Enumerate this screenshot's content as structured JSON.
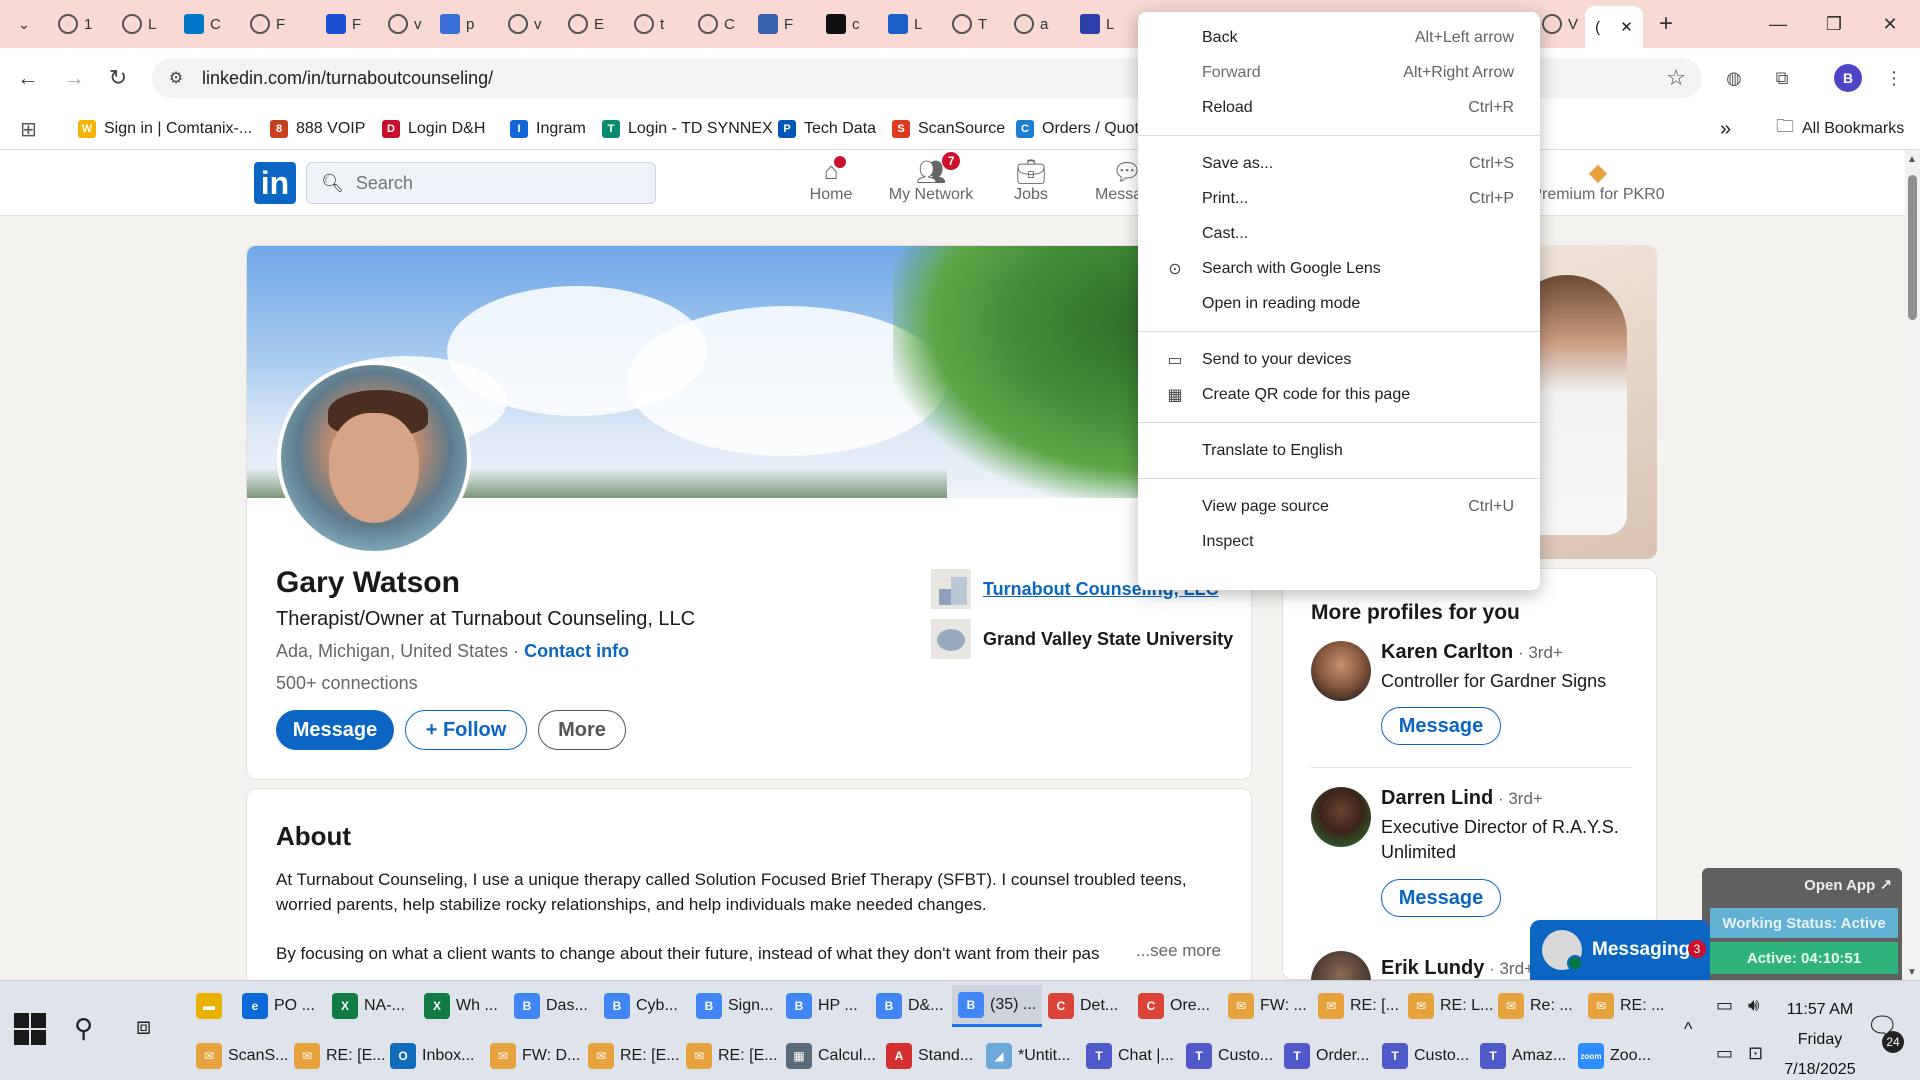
{
  "browser": {
    "tab_letters": [
      "1",
      "L",
      "C",
      "F",
      "F",
      "v",
      "p",
      "v",
      "E",
      "t",
      "C",
      "F",
      "c",
      "L",
      "T",
      "a",
      "L",
      "V"
    ],
    "active_tab_label": "(",
    "url": "linkedin.com/in/turnaboutcounseling/",
    "profile_initial": "B",
    "bookmarks": [
      {
        "label": "Sign in | Comtanix-...",
        "color": "#f2b400",
        "glyph": "W"
      },
      {
        "label": "888 VOIP",
        "color": "#c6411e",
        "glyph": "8"
      },
      {
        "label": "Login D&H",
        "color": "#c8102e",
        "glyph": "D"
      },
      {
        "label": "Ingram",
        "color": "#1366d6",
        "glyph": "I"
      },
      {
        "label": "Login - TD SYNNEX",
        "color": "#0a8a6e",
        "glyph": "T"
      },
      {
        "label": "Tech Data",
        "color": "#0057b8",
        "glyph": "P"
      },
      {
        "label": "ScanSource",
        "color": "#e03a1e",
        "glyph": "S"
      },
      {
        "label": "Orders / Quote",
        "color": "#1b7fd1",
        "glyph": "C"
      }
    ],
    "all_bookmarks_label": "All Bookmarks"
  },
  "linkedin": {
    "search_placeholder": "Search",
    "nav": [
      {
        "label": "Home",
        "badge": ""
      },
      {
        "label": "My Network",
        "badge": "7"
      },
      {
        "label": "Jobs",
        "badge": ""
      },
      {
        "label": "Messa",
        "badge": ""
      }
    ],
    "premium_label": "Premium for PKR0"
  },
  "profile": {
    "name": "Gary Watson",
    "headline": "Therapist/Owner at Turnabout Counseling, LLC",
    "location": "Ada, Michigan, United States",
    "location_sep": " · ",
    "contact_info": "Contact info",
    "connections": "500+ connections",
    "btn_message": "Message",
    "btn_follow": "+ Follow",
    "btn_more": "More",
    "company": "Turnabout Counseling, LLC",
    "school": "Grand Valley State University"
  },
  "about": {
    "title": "About",
    "p1": "At Turnabout Counseling, I use a unique therapy called Solution Focused Brief Therapy (SFBT). I counsel troubled teens, worried parents, help stabilize rocky relationships, and help individuals make needed changes.",
    "p2": "By focusing on what a client wants to change about their future, instead of what they don't want from their pas",
    "see_more": "...see more"
  },
  "more_profiles": {
    "title": "More profiles for you",
    "items": [
      {
        "name": "Karen Carlton",
        "degree": " · 3rd+",
        "title": "Controller for Gardner Signs",
        "btn": "Message"
      },
      {
        "name": "Darren Lind",
        "degree": " · 3rd+",
        "title": "Executive Director of R.A.Y.S. Unlimited",
        "btn": "Message"
      },
      {
        "name": "Erik Lundy",
        "degree": " · 3rd+",
        "title": "",
        "btn": ""
      }
    ]
  },
  "messaging": {
    "label": "Messaging",
    "badge": "3"
  },
  "open_app": {
    "label": "Open App ↗",
    "status": "Working Status: Active",
    "timer": "Active: 04:10:51"
  },
  "context_menu": [
    {
      "label": "Back",
      "key": "Alt+Left arrow",
      "icon": "",
      "disabled": false
    },
    {
      "label": "Forward",
      "key": "Alt+Right Arrow",
      "icon": "",
      "disabled": true
    },
    {
      "label": "Reload",
      "key": "Ctrl+R",
      "icon": "",
      "disabled": false
    },
    {
      "sep": true
    },
    {
      "label": "Save as...",
      "key": "Ctrl+S",
      "icon": "",
      "disabled": false
    },
    {
      "label": "Print...",
      "key": "Ctrl+P",
      "icon": "",
      "disabled": false
    },
    {
      "label": "Cast...",
      "key": "",
      "icon": "",
      "disabled": false
    },
    {
      "label": "Search with Google Lens",
      "key": "",
      "icon": "lens-icon",
      "disabled": false
    },
    {
      "label": "Open in reading mode",
      "key": "",
      "icon": "",
      "disabled": false
    },
    {
      "sep": true
    },
    {
      "label": "Send to your devices",
      "key": "",
      "icon": "devices-icon",
      "disabled": false
    },
    {
      "label": "Create QR code for this page",
      "key": "",
      "icon": "qr-code-icon",
      "disabled": false
    },
    {
      "sep": true
    },
    {
      "label": "Translate to English",
      "key": "",
      "icon": "",
      "disabled": false
    },
    {
      "sep": true
    },
    {
      "label": "View page source",
      "key": "Ctrl+U",
      "icon": "",
      "disabled": false
    },
    {
      "label": "Inspect",
      "key": "",
      "icon": "",
      "disabled": false
    }
  ],
  "taskbar": {
    "row1": [
      {
        "label": "",
        "color": "#e8b100",
        "glyph": "▬"
      },
      {
        "label": "PO ...",
        "color": "#0c6ad8",
        "glyph": "e"
      },
      {
        "label": "NA-...",
        "color": "#107c41",
        "glyph": "X"
      },
      {
        "label": "Wh ...",
        "color": "#107c41",
        "glyph": "X"
      },
      {
        "label": "Das...",
        "color": "#4285f4",
        "glyph": "B"
      },
      {
        "label": "Cyb...",
        "color": "#4285f4",
        "glyph": "B"
      },
      {
        "label": "Sign...",
        "color": "#4285f4",
        "glyph": "B"
      },
      {
        "label": "HP ...",
        "color": "#4285f4",
        "glyph": "B"
      },
      {
        "label": "D&...",
        "color": "#4285f4",
        "glyph": "B"
      },
      {
        "label": "(35) ...",
        "color": "#4285f4",
        "glyph": "B"
      },
      {
        "label": "Det...",
        "color": "#db4437",
        "glyph": "C"
      },
      {
        "label": "Ore...",
        "color": "#db4437",
        "glyph": "C"
      },
      {
        "label": "FW: ...",
        "color": "#e6a23c",
        "glyph": "✉"
      },
      {
        "label": "RE: [...",
        "color": "#e6a23c",
        "glyph": "✉"
      },
      {
        "label": "RE: L...",
        "color": "#e6a23c",
        "glyph": "✉"
      },
      {
        "label": "Re: ...",
        "color": "#e6a23c",
        "glyph": "✉"
      },
      {
        "label": "RE: ...",
        "color": "#e6a23c",
        "glyph": "✉"
      }
    ],
    "row2": [
      {
        "label": "ScanS...",
        "color": "#e6a23c",
        "glyph": "✉"
      },
      {
        "label": "RE: [E...",
        "color": "#e6a23c",
        "glyph": "✉"
      },
      {
        "label": "Inbox...",
        "color": "#0f6cbd",
        "glyph": "O"
      },
      {
        "label": "FW: D...",
        "color": "#e6a23c",
        "glyph": "✉"
      },
      {
        "label": "RE: [E...",
        "color": "#e6a23c",
        "glyph": "✉"
      },
      {
        "label": "RE: [E...",
        "color": "#e6a23c",
        "glyph": "✉"
      },
      {
        "label": "Calcul...",
        "color": "#5c6b7a",
        "glyph": "▦"
      },
      {
        "label": "Stand...",
        "color": "#d32f2f",
        "glyph": "A"
      },
      {
        "label": "*Untit...",
        "color": "#6aa9d8",
        "glyph": "◢"
      },
      {
        "label": "Chat |...",
        "color": "#5059c9",
        "glyph": "T"
      },
      {
        "label": "Custo...",
        "color": "#5059c9",
        "glyph": "T"
      },
      {
        "label": "Order...",
        "color": "#5059c9",
        "glyph": "T"
      },
      {
        "label": "Custo...",
        "color": "#5059c9",
        "glyph": "T"
      },
      {
        "label": "Amaz...",
        "color": "#5059c9",
        "glyph": "T"
      },
      {
        "label": "Zoo...",
        "color": "#2d8cff",
        "glyph": "zoom"
      }
    ],
    "time": "11:57 AM",
    "day": "Friday",
    "date": "7/18/2025",
    "notifications": "24"
  }
}
